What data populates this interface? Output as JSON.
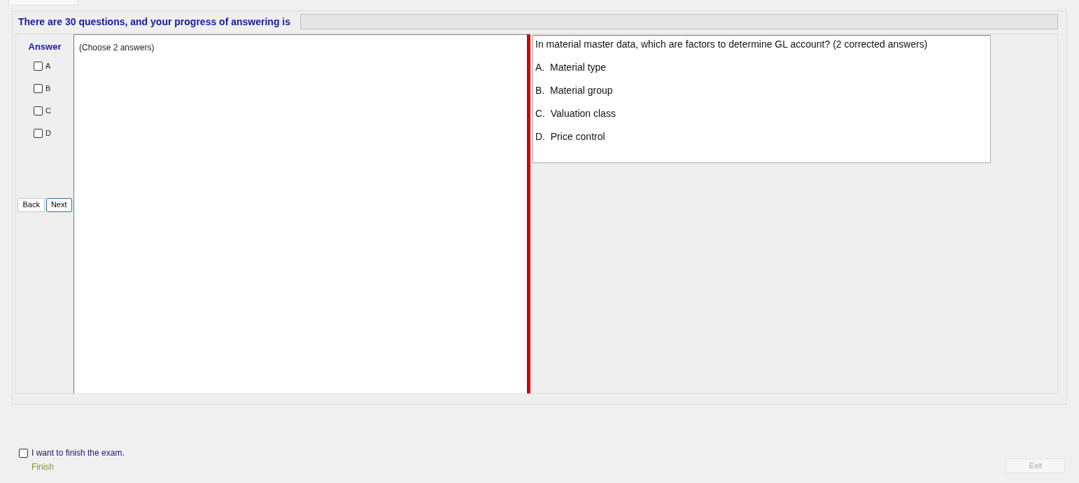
{
  "header": {
    "text": "There are 30 questions, and your progress of answering is"
  },
  "progress": {
    "level": 0
  },
  "answer_panel": {
    "title": "Answer",
    "options": [
      {
        "label": "A",
        "checked": false
      },
      {
        "label": "B",
        "checked": false
      },
      {
        "label": "C",
        "checked": false
      },
      {
        "label": "D",
        "checked": false
      }
    ],
    "buttons": [
      {
        "label": "Back",
        "selected": false
      },
      {
        "label": "Next",
        "selected": true
      }
    ]
  },
  "instruction": "(Choose 2 answers)",
  "question": {
    "text": "In material master data, which are factors to determine GL account? (2 corrected answers)",
    "choices": [
      "A.  Material type",
      "B.  Material group",
      "C.  Valuation class",
      "D.  Price control"
    ]
  },
  "finish": {
    "label": "I want to finish the exam.",
    "checked": false,
    "button": "Finish"
  },
  "exit": {
    "label": "Exit",
    "disabled": true
  }
}
